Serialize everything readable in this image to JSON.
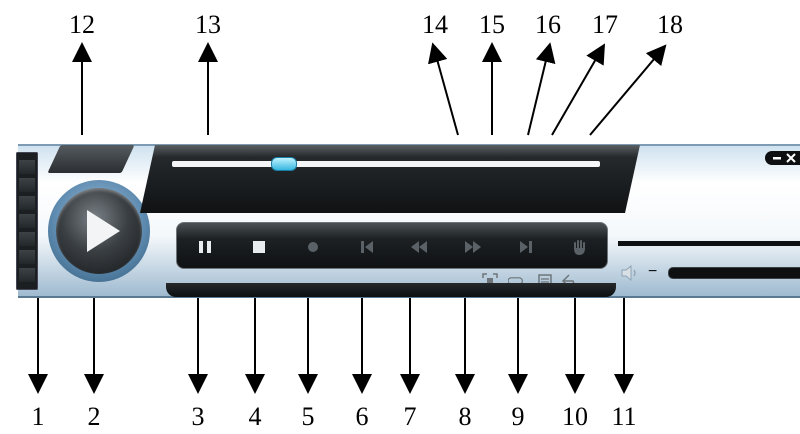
{
  "callouts": {
    "top": [
      "12",
      "13",
      "14",
      "15",
      "16",
      "17",
      "18"
    ],
    "bottom": [
      "1",
      "2",
      "3",
      "4",
      "5",
      "6",
      "7",
      "8",
      "9",
      "10",
      "11"
    ]
  },
  "player": {
    "seek_progress": 0.26,
    "colors": {
      "panel": "#1a1d20",
      "accent": "#36b7e0",
      "shell": "#d9e7f1",
      "ring": "#5f8cb1"
    },
    "controls": [
      {
        "name": "pause-icon"
      },
      {
        "name": "stop-icon"
      },
      {
        "name": "record-icon"
      },
      {
        "name": "skip-back-icon"
      },
      {
        "name": "rewind-icon"
      },
      {
        "name": "fast-forward-icon"
      },
      {
        "name": "skip-forward-icon"
      },
      {
        "name": "hand-icon"
      }
    ],
    "small_icons": [
      {
        "name": "fullscreen-icon"
      },
      {
        "name": "repeat-icon"
      },
      {
        "name": "playlist-icon"
      },
      {
        "name": "return-icon"
      }
    ],
    "volume_minus": "−"
  }
}
